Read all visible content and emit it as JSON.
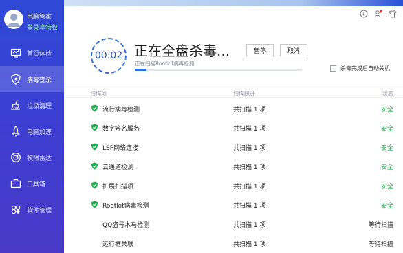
{
  "sidebar": {
    "username": "电脑管家",
    "login_link": "登录享特权",
    "items": [
      {
        "label": "首页体检",
        "icon": "monitor-icon"
      },
      {
        "label": "病毒查杀",
        "icon": "shield-bolt-icon"
      },
      {
        "label": "垃圾清理",
        "icon": "broom-icon"
      },
      {
        "label": "电脑加速",
        "icon": "rocket-icon"
      },
      {
        "label": "权限雷达",
        "icon": "radar-icon"
      },
      {
        "label": "工具箱",
        "icon": "toolbox-icon"
      },
      {
        "label": "软件管理",
        "icon": "apps-icon"
      }
    ],
    "active_index": 1
  },
  "titlebar": {
    "icons": [
      "update-icon",
      "user-add-icon",
      "skin-icon"
    ]
  },
  "scan": {
    "timer": "00:02",
    "title": "正在全盘杀毒...",
    "pause_label": "暂停",
    "cancel_label": "取消",
    "current_path": "正在扫描Rootkit病毒检测",
    "progress": 0.07,
    "auto_shutdown_label": "杀毒完成后自动关机",
    "auto_shutdown_checked": false
  },
  "table": {
    "headers": [
      "扫描项",
      "扫描统计",
      "状态"
    ],
    "rows": [
      {
        "name": "流行病毒检测",
        "count": "共扫描 1 项",
        "status": "安全",
        "done": true
      },
      {
        "name": "数字签名服务",
        "count": "共扫描 1 项",
        "status": "安全",
        "done": true
      },
      {
        "name": "LSP网络连接",
        "count": "共扫描 1 项",
        "status": "安全",
        "done": true
      },
      {
        "name": "云通道检测",
        "count": "共扫描 1 项",
        "status": "安全",
        "done": true
      },
      {
        "name": "扩展扫描项",
        "count": "共扫描 1 项",
        "status": "安全",
        "done": true
      },
      {
        "name": "Rootkit病毒检测",
        "count": "共扫描 1 项",
        "status": "安全",
        "done": true
      },
      {
        "name": "QQ盗号木马检测",
        "count": "共扫描 1 项",
        "status": "等待扫描",
        "done": false
      },
      {
        "name": "运行框关联",
        "count": "共扫描 1 项",
        "status": "等待扫描",
        "done": false
      }
    ]
  },
  "colors": {
    "sidebar": "#3a41d4",
    "accent": "#2d6fe3",
    "safe": "#17b24b"
  }
}
